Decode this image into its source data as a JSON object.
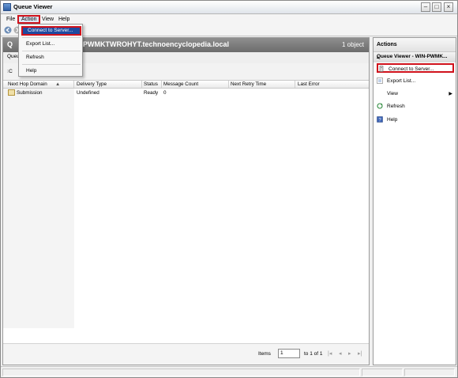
{
  "window": {
    "title": "Queue Viewer"
  },
  "menubar": {
    "file": "File",
    "action": "Action",
    "view": "View",
    "help": "Help"
  },
  "action_menu": {
    "items": [
      "Connect to Server...",
      "Export List...",
      "Refresh",
      "Help"
    ]
  },
  "content": {
    "title_letter": "Q",
    "title_server": "PWMKTWROHYT.technoencyclopedia.local",
    "object_count": "1 object",
    "subtab": "Queu",
    "sub_toolbar_label": "C",
    "columns": [
      "Next Hop Domain",
      "Delivery Type",
      "Status",
      "Message Count",
      "Next Retry Time",
      "Last Error"
    ],
    "rows": [
      {
        "domain": "Submission",
        "delivery_type": "Undefined",
        "status": "Ready",
        "message_count": "0",
        "next_retry": "",
        "last_error": ""
      }
    ],
    "pager": {
      "items_label": "Items",
      "page_value": "1",
      "range_label": "to 1 of 1"
    }
  },
  "actions": {
    "header": "Actions",
    "section": "Queue Viewer - WIN-PWMK...",
    "items": [
      {
        "label": "Connect to Server...",
        "icon": "connect-server-icon"
      },
      {
        "label": "Export List...",
        "icon": "export-list-icon"
      },
      {
        "label": "View",
        "icon": ""
      },
      {
        "label": "Refresh",
        "icon": "refresh-icon"
      },
      {
        "label": "Help",
        "icon": "help-icon"
      }
    ]
  },
  "colors": {
    "highlight_border": "#d0121c",
    "menu_highlight": "#1f4aa0",
    "header_gray": "#7a7a7a"
  }
}
